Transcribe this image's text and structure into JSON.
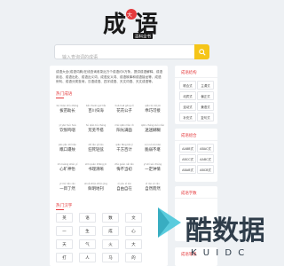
{
  "logo": {
    "text": "成语",
    "small_badge": "大全",
    "stamp": "百科全书"
  },
  "search": {
    "placeholder": "输入查询词的成语"
  },
  "intro": "成语大全(成语词典)在线查询收录近万个成语约5万条，提供成语解释、成语用法、成语出处、成语近义词、成语反义词、成语故事和成语接龙等，成语例句、成语分类查询，汉语成语、四字成语、天文词语、天文成语等。",
  "hot": {
    "title": "热门成语",
    "rows": [
      [
        {
          "py": "bá miáo zhù zhǎng",
          "w": "拔苗助长"
        },
        {
          "py": "bǎi chuān guī hǎi",
          "w": "百川归海"
        },
        {
          "py": "huā huā gōng zǐ",
          "w": "花花公子"
        },
        {
          "py": "qiǎo bù kě jiē",
          "w": "乖巧可接"
        }
      ],
      [
        {
          "py": "yī yāo huò huà",
          "w": "饮恨鸣咽"
        },
        {
          "py": "hú qiǎo bù chéng",
          "w": "荒芜不搭"
        },
        {
          "py": "méi qiāo mǎn dì",
          "w": "阳光满面"
        },
        {
          "py": "qiān cháng zuò niǎo",
          "w": "迷迷糊糊"
        }
      ],
      [
        {
          "py": "jiāo jiǎn zhǐ liǎn",
          "w": "瞧口遭殃"
        },
        {
          "py": "zhǐ lǎo yě lǎo",
          "w": "狂死轻弦"
        },
        {
          "py": "qiān fāng bǎi jì",
          "w": "千方百计"
        },
        {
          "py": "cuì ruò bù kān",
          "w": "脆弱不堪"
        }
      ],
      [
        {
          "py": "xīn kuàng shén yí",
          "w": "心旷神怡"
        },
        {
          "py": "shū quán zhēng jū",
          "w": "书理清晰"
        },
        {
          "py": "zhè guǎn nǎi lǎo",
          "w": "悔不当初"
        },
        {
          "py": "yī shì wú chéng",
          "w": "一定钟情"
        }
      ],
      [
        {
          "py": "yī mù liǎo rán",
          "w": "一目了然"
        },
        {
          "py": "shuǎ zhǎo zhǎn jìng",
          "w": "鲜明地刊"
        },
        {
          "py": "zì yóu zì zài",
          "w": "自由自在"
        },
        {
          "py": "zì rán ér rán",
          "w": "自然而然"
        }
      ]
    ]
  },
  "chars": {
    "title": "热门汉字",
    "rows": [
      [
        "英",
        "语",
        "数",
        "文"
      ],
      [
        "一",
        "生",
        "成",
        "心"
      ],
      [
        "天",
        "气",
        "火",
        "大"
      ],
      [
        "打",
        "人",
        "马",
        "的"
      ]
    ]
  },
  "sidebar": {
    "structure": {
      "title": "成语结构",
      "tags": [
        "联合式",
        "主谓式",
        "动宾式",
        "偏正式",
        "连动式",
        "兼语式",
        "补充式",
        "复句式",
        "紧缩式"
      ]
    },
    "combo": {
      "title": "成语组合",
      "tags": [
        "AABB式",
        "ABAC式",
        "ABCC式",
        "AABC式",
        "ABAB式",
        "ABCB式",
        "ABBC式",
        "ABCA式"
      ]
    },
    "char_count": {
      "title": "成语字数"
    },
    "level": {
      "title": "成语等级"
    }
  },
  "watermark": {
    "brand": "酷数据",
    "sub": "K U I D C"
  },
  "colors": {
    "accent": "#e4393c",
    "search_button": "#f5c518",
    "watermark": "#2f3d4a",
    "play": "#40c4d8"
  }
}
